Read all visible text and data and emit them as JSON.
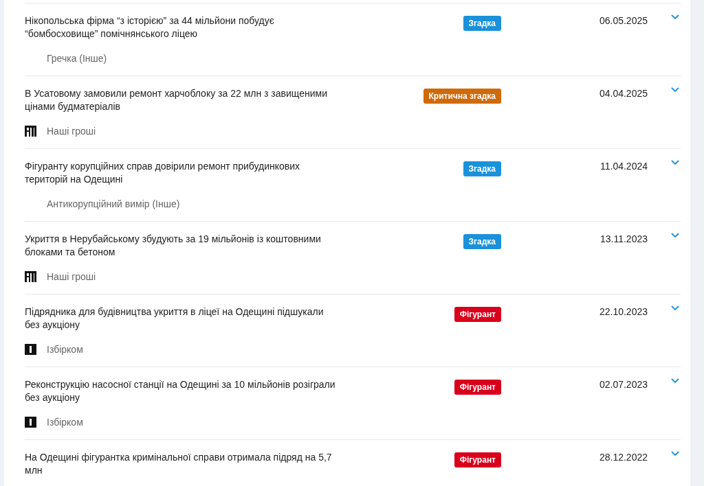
{
  "articles": [
    {
      "title": "Нікопольська фірма “з історією” за 44 мільйони побудує “бомбосховище” помічнянського ліцею",
      "tag": {
        "label": "Згадка",
        "color": "#1a91da"
      },
      "date": "06.05.2025",
      "source": {
        "kind": "plain",
        "name": "Гречка (Інше)"
      }
    },
    {
      "title": "В Усатовому замовили ремонт харчоблоку за 22 млн з завищеними цінами будматеріалів",
      "tag": {
        "label": "Критична згадка",
        "color": "#d0690a"
      },
      "date": "04.04.2025",
      "source": {
        "kind": "ng",
        "name": "Наші гроші"
      }
    },
    {
      "title": "Фігуранту корупційних справ довірили ремонт прибудинкових територій на Одещині",
      "tag": {
        "label": "Згадка",
        "color": "#1a91da"
      },
      "date": "11.04.2024",
      "source": {
        "kind": "plain",
        "name": "Антикорупційний вимір (Інше)"
      }
    },
    {
      "title": "Укриття в Нерубайському збудують за 19 мільйонів із коштовними блоками та бетоном",
      "tag": {
        "label": "Згадка",
        "color": "#1a91da"
      },
      "date": "13.11.2023",
      "source": {
        "kind": "ng",
        "name": "Наші гроші"
      }
    },
    {
      "title": "Підрядника для будівництва укриття в ліцеї на Одещині підшукали без аукціону",
      "tag": {
        "label": "Фігурант",
        "color": "#d9001b"
      },
      "date": "22.10.2023",
      "source": {
        "kind": "izbirkom",
        "name": "Ізбірком"
      }
    },
    {
      "title": "Реконструкцію насосної станції на Одещині за 10 мільйонів розіграли без аукціону",
      "tag": {
        "label": "Фігурант",
        "color": "#d9001b"
      },
      "date": "02.07.2023",
      "source": {
        "kind": "izbirkom",
        "name": "Ізбірком"
      }
    },
    {
      "title": "На Одещині фігурантка кримінальної справи отримала підряд на 5,7 млн",
      "tag": {
        "label": "Фігурант",
        "color": "#d9001b"
      },
      "date": "28.12.2022"
    }
  ]
}
